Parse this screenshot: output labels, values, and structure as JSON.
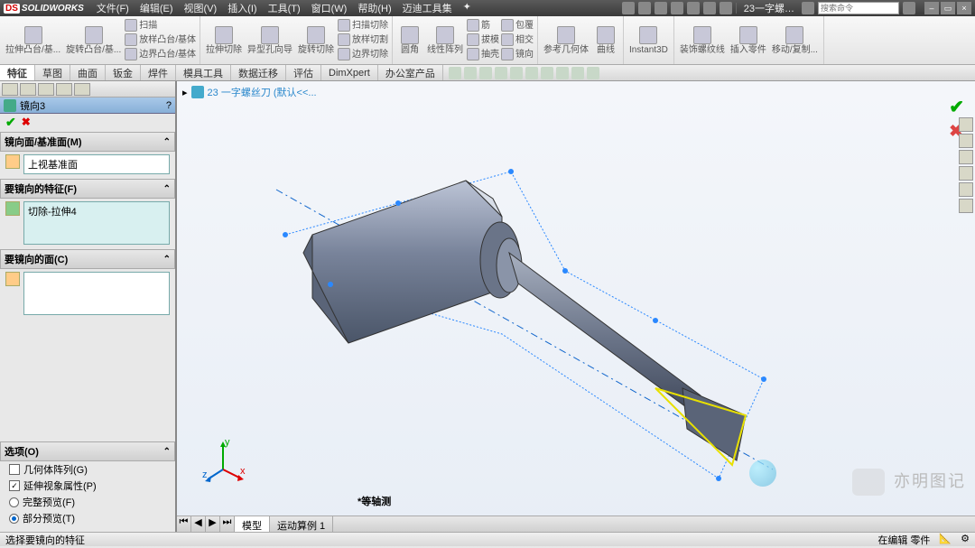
{
  "app": {
    "logo": "DS",
    "name": "SOLIDWORKS",
    "doc": "23一字螺…",
    "search_placeholder": "搜索命令"
  },
  "menus": [
    "文件(F)",
    "编辑(E)",
    "视图(V)",
    "插入(I)",
    "工具(T)",
    "窗口(W)",
    "帮助(H)",
    "迈迪工具集"
  ],
  "ribbon": {
    "g1": [
      {
        "top": "拉伸凸台/基...",
        "icon": "extrude"
      },
      {
        "top": "旋转凸台/基...",
        "icon": "revolve"
      },
      {
        "rows": [
          "扫描",
          "放样凸台/基体",
          "边界凸台/基体"
        ]
      }
    ],
    "g2": [
      {
        "top": "拉伸切除",
        "icon": "cut-extrude"
      },
      {
        "top": "异型孔向导",
        "icon": "hole-wizard"
      },
      {
        "top": "旋转切除",
        "icon": "cut-revolve"
      },
      {
        "rows": [
          "扫描切除",
          "放样切割",
          "边界切除"
        ]
      }
    ],
    "g3": [
      {
        "top": "圆角",
        "icon": "fillet"
      },
      {
        "rows": [
          "线性阵列"
        ]
      },
      {
        "rows": [
          "筋",
          "拔模",
          "抽壳"
        ]
      },
      {
        "rows": [
          "包覆",
          "相交",
          "镜向"
        ]
      }
    ],
    "g4": [
      {
        "top": "参考几何体",
        "icon": "ref-geom"
      },
      {
        "top": "曲线",
        "icon": "curves"
      }
    ],
    "g5": [
      {
        "top": "Instant3D",
        "icon": "instant3d"
      }
    ],
    "g6": [
      {
        "top": "装饰螺纹线",
        "icon": "thread"
      },
      {
        "top": "插入零件",
        "icon": "insert-part"
      },
      {
        "top": "移动/复制...",
        "icon": "move-copy"
      }
    ]
  },
  "tabs": [
    "特征",
    "草图",
    "曲面",
    "钣金",
    "焊件",
    "模具工具",
    "数据迁移",
    "评估",
    "DimXpert",
    "办公室产品"
  ],
  "active_tab": "特征",
  "panel": {
    "title": "镜向3",
    "section1": {
      "label": "镜向面/基准面(M)",
      "value": "上视基准面"
    },
    "section2": {
      "label": "要镜向的特征(F)",
      "value": "切除-拉伸4"
    },
    "section3": {
      "label": "要镜向的面(C)",
      "value": ""
    },
    "options": {
      "label": "选项(O)",
      "items": [
        {
          "kind": "checkbox",
          "label": "几何体阵列(G)",
          "checked": false
        },
        {
          "kind": "checkbox",
          "label": "延伸视象属性(P)",
          "checked": true
        },
        {
          "kind": "radio",
          "label": "完整预览(F)",
          "checked": false
        },
        {
          "kind": "radio",
          "label": "部分预览(T)",
          "checked": true
        }
      ]
    }
  },
  "viewport": {
    "breadcrumb": "23 一字螺丝刀   (默认<<...",
    "view_label": "*等轴测",
    "triad": {
      "x": "x",
      "y": "y",
      "z": "z"
    }
  },
  "bottom_tabs": [
    "模型",
    "运动算例 1"
  ],
  "status": {
    "left": "选择要镜向的特征",
    "right1": "在编辑 零件",
    "right2": ""
  },
  "watermark": "亦明图记"
}
